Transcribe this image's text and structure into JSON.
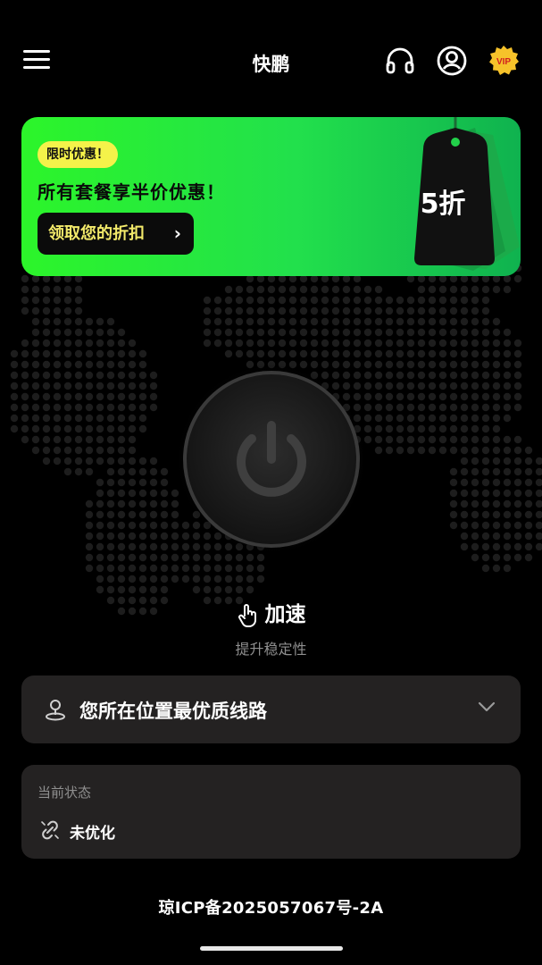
{
  "header": {
    "title": "快鹏",
    "vip_label": "VIP",
    "icons": [
      "menu-icon",
      "headset-icon",
      "user-icon",
      "vip-badge-icon"
    ]
  },
  "promo": {
    "tag": "限时优惠！",
    "headline": "所有套餐享半价优惠！",
    "button_label": "领取您的折扣",
    "discount": "5折",
    "colors": {
      "start": "#2cf52a",
      "end": "#0fb24f",
      "badge": "#f4f24a",
      "button_text": "#f2e96a"
    }
  },
  "connect": {
    "action_label": "加速",
    "subtitle": "提升稳定性",
    "icons": [
      "power-icon",
      "pointer-hand-icon"
    ]
  },
  "location": {
    "label": "您所在位置最优质线路",
    "icons": [
      "location-pin-icon",
      "chevron-down-icon"
    ]
  },
  "status": {
    "label": "当前状态",
    "value": "未优化",
    "icon": "broken-link-icon"
  },
  "footer": {
    "icp": "琼ICP备2025057067号-2A"
  }
}
